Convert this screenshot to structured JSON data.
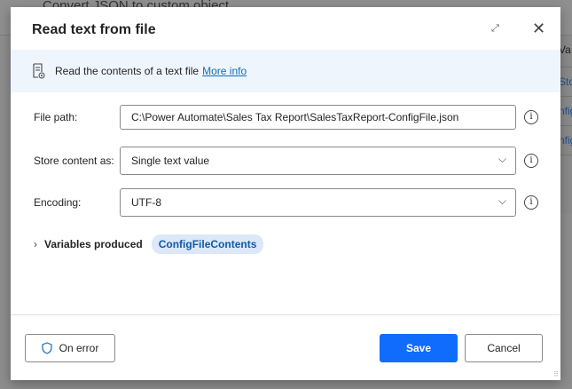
{
  "background": {
    "title": "Convert JSON to custom object",
    "right_items": [
      "Va",
      "Sto",
      "nfig",
      "nfig"
    ]
  },
  "dialog": {
    "title": "Read text from file",
    "description": "Read the contents of a text file",
    "more_info": "More info",
    "fields": [
      {
        "label": "File path:",
        "value": "C:\\Power Automate\\Sales Tax Report\\SalesTaxReport-ConfigFile.json",
        "type": "text"
      },
      {
        "label": "Store content as:",
        "value": "Single text value",
        "type": "select"
      },
      {
        "label": "Encoding:",
        "value": "UTF-8",
        "type": "select"
      }
    ],
    "variables_label": "Variables produced",
    "variables": [
      "ConfigFileContents"
    ],
    "on_error": "On error",
    "save": "Save",
    "cancel": "Cancel"
  },
  "colors": {
    "primary": "#0f6cfd",
    "info_bg": "#eff5fd",
    "link": "#0f6cbd"
  }
}
